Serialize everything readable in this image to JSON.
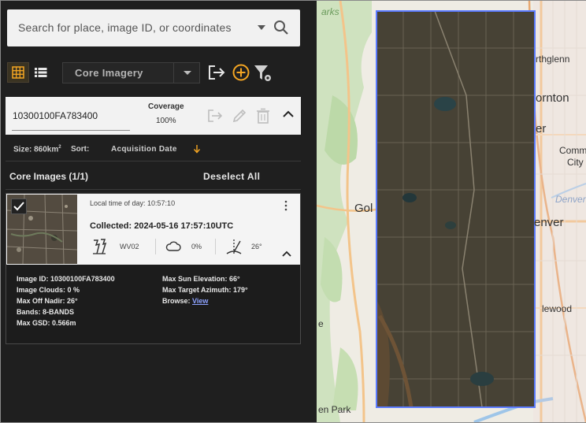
{
  "search": {
    "placeholder": "Search for place, image ID, or coordinates"
  },
  "toolbar": {
    "collection_label": "Core Imagery",
    "icons": [
      "grid-view-icon",
      "list-view-icon",
      "chevron-down-icon",
      "export-icon",
      "add-circle-icon",
      "filter-settings-icon"
    ],
    "accent_color": "#f5a623"
  },
  "aoi": {
    "id": "10300100FA783400",
    "coverage_label": "Coverage",
    "coverage_value": "100%",
    "size_prefix": "Size: 860km",
    "size_sup": "2",
    "sort_label": "Sort:",
    "sort_value": "Acquisition Date"
  },
  "core_images": {
    "title": "Core Images (1/1)",
    "deselect_all": "Deselect All"
  },
  "image": {
    "local_time": "Local time of day: 10:57:10",
    "collected": "Collected: 2024-05-16 17:57:10UTC",
    "satellite": "WV02",
    "clouds": "0%",
    "off_nadir": "26°",
    "details": {
      "image_id_label": "Image ID:",
      "image_id": "10300100FA783400",
      "clouds_label": "Image Clouds:",
      "clouds": "0 %",
      "off_nadir_label": "Max Off Nadir:",
      "off_nadir": "26°",
      "bands_label": "Bands:",
      "bands": "8-BANDS",
      "gsd_label": "Max GSD:",
      "gsd": "0.566m",
      "sun_label": "Max Sun Elevation:",
      "sun": "66°",
      "azimuth_label": "Max Target Azimuth:",
      "azimuth": "179°",
      "browse_label": "Browse:",
      "browse_link": "View"
    }
  },
  "map": {
    "labels": {
      "northglenn": "rthglenn",
      "thornton": "ornton",
      "er": "er",
      "comm": "Comm",
      "city": "City",
      "denver_italic": "Denver",
      "golden": "Gol",
      "denver": "enver",
      "englewood": "lewood",
      "parks": "arks",
      "park": "en Park",
      "e": "e"
    },
    "footprint_color": "#5b7bff"
  }
}
